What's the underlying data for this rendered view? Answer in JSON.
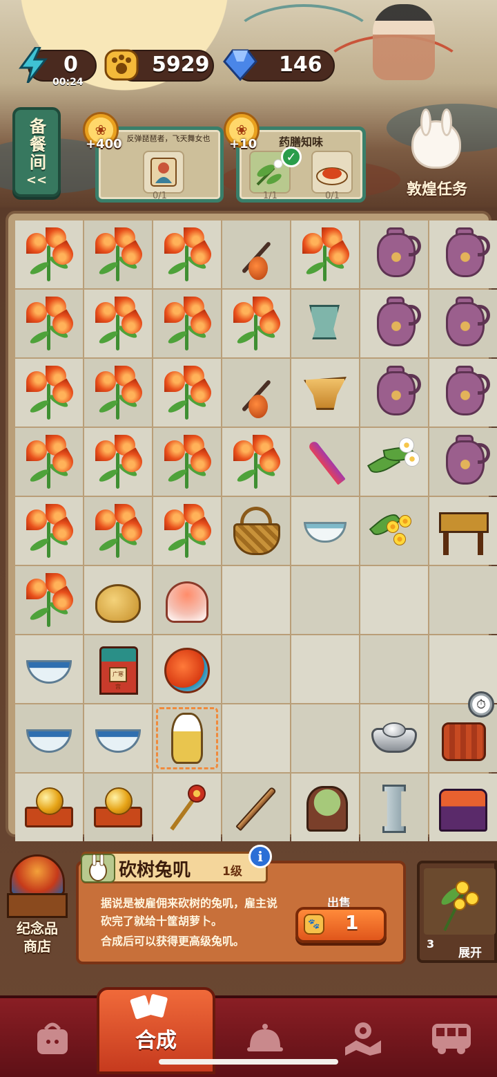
{
  "resources": {
    "energy": "0",
    "timer": "00:24",
    "coins": "5929",
    "gems": "146"
  },
  "kitchen_tab": {
    "label": "备餐间",
    "arrow": "<<"
  },
  "orders": [
    {
      "bonus": "+400",
      "title": "反弹琵琶者，飞天舞女也",
      "progress": "0/1"
    },
    {
      "bonus": "+10",
      "title": "药膳知味",
      "progress_a": "1/1",
      "progress_b": "0/1"
    }
  ],
  "task_button": {
    "label": "敦煌任务"
  },
  "board": {
    "rows": [
      [
        "lily",
        "lily",
        "lily",
        "gourd",
        "lily",
        "vase",
        "vase"
      ],
      [
        "lily",
        "lily",
        "lily",
        "lily",
        "cup",
        "vase",
        "vase"
      ],
      [
        "lily",
        "lily",
        "lily",
        "gourd",
        "jue",
        "vase",
        "vase"
      ],
      [
        "lily",
        "lily",
        "lily",
        "lily",
        "rocket",
        "herb",
        "vase"
      ],
      [
        "lily",
        "lily",
        "lily",
        "basket",
        "plain-bowl",
        "yellow-flower",
        "table"
      ],
      [
        "lily",
        "toad",
        "lotus-fish",
        "",
        "",
        "",
        ""
      ],
      [
        "blue-bowl",
        "gate",
        "koi",
        "",
        "",
        "",
        ""
      ],
      [
        "blue-bowl",
        "blue-bowl",
        "rabbit",
        "",
        "",
        "silver-ingot",
        "drum"
      ],
      [
        "gold-ball",
        "gold-ball",
        "scepter",
        "sword",
        "tree",
        "pillar",
        "shrine"
      ]
    ],
    "gate_plate_text": "广寒宫"
  },
  "item_info": {
    "name": "砍树兔叽",
    "level": "1级",
    "description": "据说是被雇佣来砍树的兔叽，雇主说砍完了就给十筐胡萝卜。",
    "hint": "合成后可以获得更高级兔叽。",
    "sell_label": "出售",
    "sell_value": "1"
  },
  "shop": {
    "label_line1": "纪念品",
    "label_line2": "商店"
  },
  "expand": {
    "count": "3",
    "label": "展开"
  },
  "nav": {
    "active_label": "合成"
  }
}
